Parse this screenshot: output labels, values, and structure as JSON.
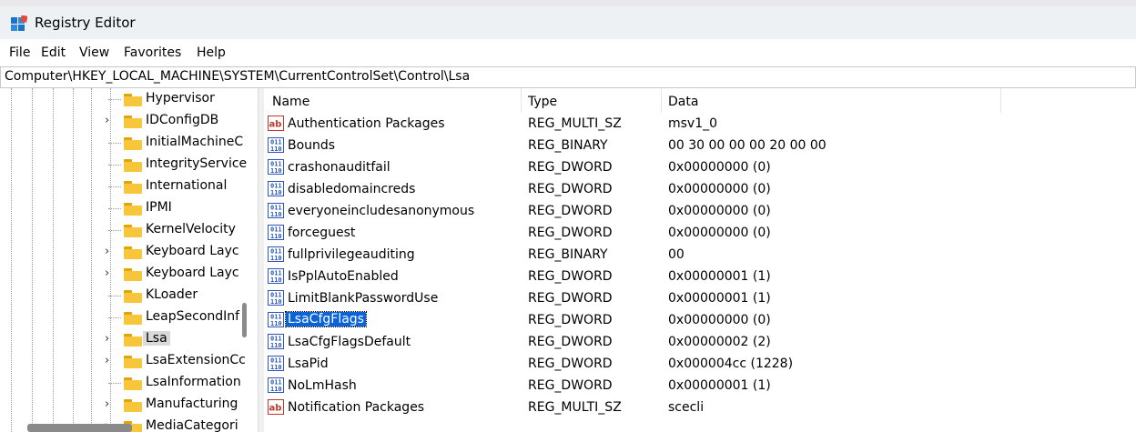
{
  "window": {
    "title": "Registry Editor"
  },
  "menu": [
    "File",
    "Edit",
    "View",
    "Favorites",
    "Help"
  ],
  "address": "Computer\\HKEY_LOCAL_MACHINE\\SYSTEM\\CurrentControlSet\\Control\\Lsa",
  "tree": {
    "items": [
      {
        "label": "Hypervisor",
        "expandable": false,
        "selected": false
      },
      {
        "label": "IDConfigDB",
        "expandable": true,
        "selected": false
      },
      {
        "label": "InitialMachineC",
        "expandable": false,
        "selected": false
      },
      {
        "label": "IntegrityService",
        "expandable": false,
        "selected": false
      },
      {
        "label": "International",
        "expandable": false,
        "selected": false
      },
      {
        "label": "IPMI",
        "expandable": false,
        "selected": false
      },
      {
        "label": "KernelVelocity",
        "expandable": false,
        "selected": false
      },
      {
        "label": "Keyboard Layc",
        "expandable": true,
        "selected": false
      },
      {
        "label": "Keyboard Layc",
        "expandable": true,
        "selected": false
      },
      {
        "label": "KLoader",
        "expandable": false,
        "selected": false
      },
      {
        "label": "LeapSecondInf",
        "expandable": false,
        "selected": false
      },
      {
        "label": "Lsa",
        "expandable": true,
        "selected": true
      },
      {
        "label": "LsaExtensionCc",
        "expandable": true,
        "selected": false
      },
      {
        "label": "LsaInformation",
        "expandable": false,
        "selected": false
      },
      {
        "label": "Manufacturing",
        "expandable": true,
        "selected": false
      },
      {
        "label": "MediaCategori",
        "expandable": true,
        "selected": false
      }
    ]
  },
  "columns": {
    "name": "Name",
    "type": "Type",
    "data": "Data"
  },
  "values": [
    {
      "name": "Authentication Packages",
      "type": "REG_MULTI_SZ",
      "data": "msv1_0",
      "icon": "string-value-icon",
      "selected": false
    },
    {
      "name": "Bounds",
      "type": "REG_BINARY",
      "data": "00 30 00 00 00 20 00 00",
      "icon": "binary-value-icon",
      "selected": false
    },
    {
      "name": "crashonauditfail",
      "type": "REG_DWORD",
      "data": "0x00000000 (0)",
      "icon": "binary-value-icon",
      "selected": false
    },
    {
      "name": "disabledomaincreds",
      "type": "REG_DWORD",
      "data": "0x00000000 (0)",
      "icon": "binary-value-icon",
      "selected": false
    },
    {
      "name": "everyoneincludesanonymous",
      "type": "REG_DWORD",
      "data": "0x00000000 (0)",
      "icon": "binary-value-icon",
      "selected": false
    },
    {
      "name": "forceguest",
      "type": "REG_DWORD",
      "data": "0x00000000 (0)",
      "icon": "binary-value-icon",
      "selected": false
    },
    {
      "name": "fullprivilegeauditing",
      "type": "REG_BINARY",
      "data": "00",
      "icon": "binary-value-icon",
      "selected": false
    },
    {
      "name": "IsPplAutoEnabled",
      "type": "REG_DWORD",
      "data": "0x00000001 (1)",
      "icon": "binary-value-icon",
      "selected": false
    },
    {
      "name": "LimitBlankPasswordUse",
      "type": "REG_DWORD",
      "data": "0x00000001 (1)",
      "icon": "binary-value-icon",
      "selected": false
    },
    {
      "name": "LsaCfgFlags",
      "type": "REG_DWORD",
      "data": "0x00000000 (0)",
      "icon": "binary-value-icon",
      "selected": true
    },
    {
      "name": "LsaCfgFlagsDefault",
      "type": "REG_DWORD",
      "data": "0x00000002 (2)",
      "icon": "binary-value-icon",
      "selected": false
    },
    {
      "name": "LsaPid",
      "type": "REG_DWORD",
      "data": "0x000004cc (1228)",
      "icon": "binary-value-icon",
      "selected": false
    },
    {
      "name": "NoLmHash",
      "type": "REG_DWORD",
      "data": "0x00000001 (1)",
      "icon": "binary-value-icon",
      "selected": false
    },
    {
      "name": "Notification Packages",
      "type": "REG_MULTI_SZ",
      "data": "scecli",
      "icon": "string-value-icon",
      "selected": false
    }
  ],
  "colors": {
    "selection": "#0a64d8",
    "folder": "#f8c63a",
    "tree_selection": "#d9d9d9"
  }
}
